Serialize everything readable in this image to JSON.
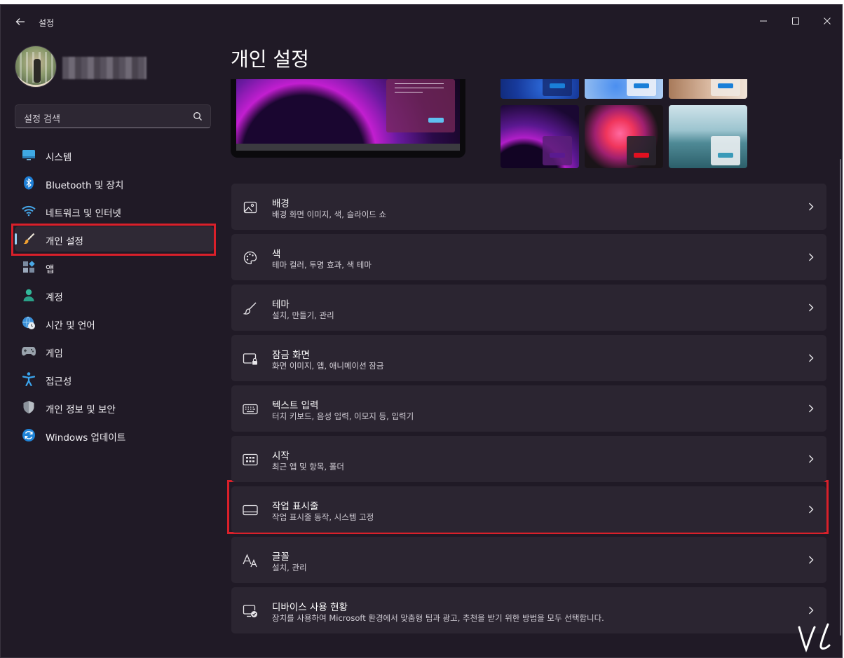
{
  "app": {
    "title": "설정"
  },
  "page": {
    "title": "개인 설정"
  },
  "search": {
    "placeholder": "설정 검색"
  },
  "sidebar": {
    "items": [
      {
        "label": "시스템",
        "icon": "monitor-icon"
      },
      {
        "label": "Bluetooth 및 장치",
        "icon": "bluetooth-icon"
      },
      {
        "label": "네트워크 및 인터넷",
        "icon": "wifi-icon"
      },
      {
        "label": "개인 설정",
        "icon": "paintbrush-icon",
        "selected": true
      },
      {
        "label": "앱",
        "icon": "apps-icon"
      },
      {
        "label": "계정",
        "icon": "person-icon"
      },
      {
        "label": "시간 및 언어",
        "icon": "globe-clock-icon"
      },
      {
        "label": "게임",
        "icon": "gamepad-icon"
      },
      {
        "label": "접근성",
        "icon": "accessibility-icon"
      },
      {
        "label": "개인 정보 및 보안",
        "icon": "shield-icon"
      },
      {
        "label": "Windows 업데이트",
        "icon": "update-icon"
      }
    ]
  },
  "settings": [
    {
      "title": "배경",
      "desc": "배경 화면 이미지, 색, 슬라이드 쇼",
      "icon": "image-icon"
    },
    {
      "title": "색",
      "desc": "테마 컬러, 투명 효과, 색 테마",
      "icon": "palette-icon"
    },
    {
      "title": "테마",
      "desc": "설치, 만들기, 관리",
      "icon": "brush-icon"
    },
    {
      "title": "잠금 화면",
      "desc": "화면 이미지, 앱, 애니메이션 잠금",
      "icon": "lock-screen-icon"
    },
    {
      "title": "텍스트 입력",
      "desc": "터치 키보드, 음성 입력, 이모지 등, 입력기",
      "icon": "keyboard-icon"
    },
    {
      "title": "시작",
      "desc": "최근 앱 및 항목, 폴더",
      "icon": "start-grid-icon"
    },
    {
      "title": "작업 표시줄",
      "desc": "작업 표시줄 동작, 시스템 고정",
      "icon": "taskbar-icon"
    },
    {
      "title": "글꼴",
      "desc": "설치, 관리",
      "icon": "font-icon"
    },
    {
      "title": "디바이스 사용 현황",
      "desc": "장치를 사용하여 Microsoft 환경에서 맞춤형 팁과 광고, 추천을 받기 위한 방법을 모두 선택합니다.",
      "icon": "device-usage-icon"
    }
  ],
  "colors": {
    "window_bg": "#201a26",
    "card_bg": "#2b2531",
    "accent": "#9ad1f5",
    "highlight_border": "#d9202a"
  }
}
